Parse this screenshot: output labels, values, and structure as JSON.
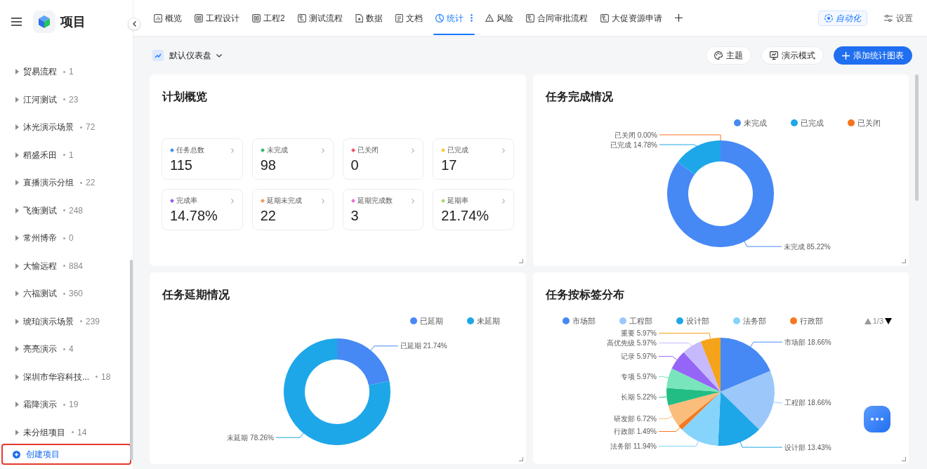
{
  "sidebar": {
    "title": "项目",
    "projects": [
      {
        "name": "贸易流程",
        "count": "1",
        "expanded": false
      },
      {
        "name": "江河测试",
        "count": "23",
        "expanded": false
      },
      {
        "name": "沐光演示场景",
        "count": "72",
        "expanded": false
      },
      {
        "name": "稻盛禾田",
        "count": "1",
        "expanded": false
      },
      {
        "name": "直播演示分组",
        "count": "22",
        "expanded": false
      },
      {
        "name": "飞衡测试",
        "count": "248",
        "expanded": false
      },
      {
        "name": "常州博帝",
        "count": "0",
        "expanded": false
      },
      {
        "name": "大愉远程",
        "count": "884",
        "expanded": false
      },
      {
        "name": "六福测试",
        "count": "360",
        "expanded": false
      },
      {
        "name": "琥珀演示场景",
        "count": "239",
        "expanded": false
      },
      {
        "name": "亮亮演示",
        "count": "4",
        "expanded": false
      },
      {
        "name": "深圳市华容科技...",
        "count": "18",
        "expanded": false
      },
      {
        "name": "霜降演示",
        "count": "19",
        "expanded": false
      },
      {
        "name": "未分组项目",
        "count": "14",
        "expanded": false
      }
    ],
    "create_button": {
      "label": "创建项目",
      "highlighted": true
    }
  },
  "tabs": [
    {
      "label": "概览",
      "kind": "overview",
      "selected": false
    },
    {
      "label": "工程设计",
      "kind": "board",
      "selected": false
    },
    {
      "label": "工程2",
      "kind": "board",
      "selected": false
    },
    {
      "label": "测试流程",
      "kind": "workflow",
      "selected": false
    },
    {
      "label": "数据",
      "kind": "data",
      "selected": false
    },
    {
      "label": "文档",
      "kind": "doc",
      "selected": false
    },
    {
      "label": "统计",
      "kind": "stats",
      "selected": true
    },
    {
      "label": "风险",
      "kind": "risk",
      "selected": false
    },
    {
      "label": "合同审批流程",
      "kind": "workflow",
      "selected": false
    },
    {
      "label": "大促资源申请",
      "kind": "workflow",
      "selected": false
    }
  ],
  "header_actions": {
    "automation": "自动化",
    "settings": "设置"
  },
  "toolbar": {
    "dashboard": "默认仪表盘",
    "buttons": [
      {
        "label": "主题",
        "kind": "theme"
      },
      {
        "label": "演示模式",
        "kind": "present"
      },
      {
        "label": "添加统计图表",
        "kind": "add"
      }
    ]
  },
  "plan_overview": {
    "title": "计划概览",
    "stats": [
      {
        "label": "任务总数",
        "value": "115",
        "color": "#3d8ef5"
      },
      {
        "label": "未完成",
        "value": "98",
        "color": "#2fba66"
      },
      {
        "label": "已关闭",
        "value": "0",
        "color": "#f0506e"
      },
      {
        "label": "已完成",
        "value": "17",
        "color": "#fcc536"
      },
      {
        "label": "完成率",
        "value": "14.78%",
        "color": "#9a5ae6"
      },
      {
        "label": "延期未完成",
        "value": "22",
        "color": "#f0975a"
      },
      {
        "label": "延期完成数",
        "value": "3",
        "color": "#e273d5"
      },
      {
        "label": "延期率",
        "value": "21.74%",
        "color": "#a3da6f"
      }
    ]
  },
  "completion_panel": {
    "title": "任务完成情况",
    "legend": [
      {
        "label": "未完成",
        "color": "#4689f5"
      },
      {
        "label": "已完成",
        "color": "#1ea7e8"
      },
      {
        "label": "已关闭",
        "color": "#f6731b"
      }
    ],
    "chart_data": {
      "type": "donut",
      "categories": [
        "未完成",
        "已完成",
        "已关闭"
      ],
      "values": [
        85.22,
        14.78,
        0
      ],
      "colors": [
        "#4689f5",
        "#1ea7e8",
        "#f6731b"
      ],
      "value_labels": [
        "85.22%",
        "14.78%",
        "0.00%"
      ]
    }
  },
  "delay_panel": {
    "title": "任务延期情况",
    "legend": [
      {
        "label": "已延期",
        "color": "#4689f5"
      },
      {
        "label": "未延期",
        "color": "#1ea7e8"
      }
    ],
    "chart_data": {
      "type": "donut",
      "categories": [
        "已延期",
        "未延期"
      ],
      "values": [
        21.74,
        78.26
      ],
      "colors": [
        "#4689f5",
        "#1ea7e8"
      ],
      "value_labels": [
        "21.74%",
        "78.26%"
      ]
    }
  },
  "tag_panel": {
    "title": "任务按标签分布",
    "legend": [
      {
        "label": "市场部",
        "color": "#4689f5"
      },
      {
        "label": "工程部",
        "color": "#9cc7fb"
      },
      {
        "label": "设计部",
        "color": "#1ea7e8"
      },
      {
        "label": "法务部",
        "color": "#86d4fb"
      },
      {
        "label": "行政部",
        "color": "#f6791f"
      }
    ],
    "legend_pager": {
      "label": "1/3",
      "prev_disabled": true,
      "next_disabled": false
    },
    "chart_data": {
      "type": "pie",
      "categories": [
        "市场部",
        "工程部",
        "设计部",
        "法务部",
        "行政部",
        "研发部",
        "长期",
        "专项",
        "记录",
        "高优先级",
        "重要"
      ],
      "values": [
        18.66,
        18.66,
        13.43,
        11.94,
        1.49,
        6.72,
        5.22,
        5.97,
        5.97,
        5.97,
        5.97
      ],
      "colors": [
        "#4689f5",
        "#9cc7fb",
        "#1ea7e8",
        "#86d4fb",
        "#f6791f",
        "#fbbd7c",
        "#22bd85",
        "#79e5bd",
        "#9465f6",
        "#c6b9fd",
        "#f5a31a"
      ],
      "value_labels": [
        "18.66%",
        "18.66%",
        "13.43%",
        "11.94%",
        "1.49%",
        "6.72%",
        "5.22%",
        "5.97%",
        "5.97%",
        "5.97%",
        "5.97%"
      ]
    }
  }
}
